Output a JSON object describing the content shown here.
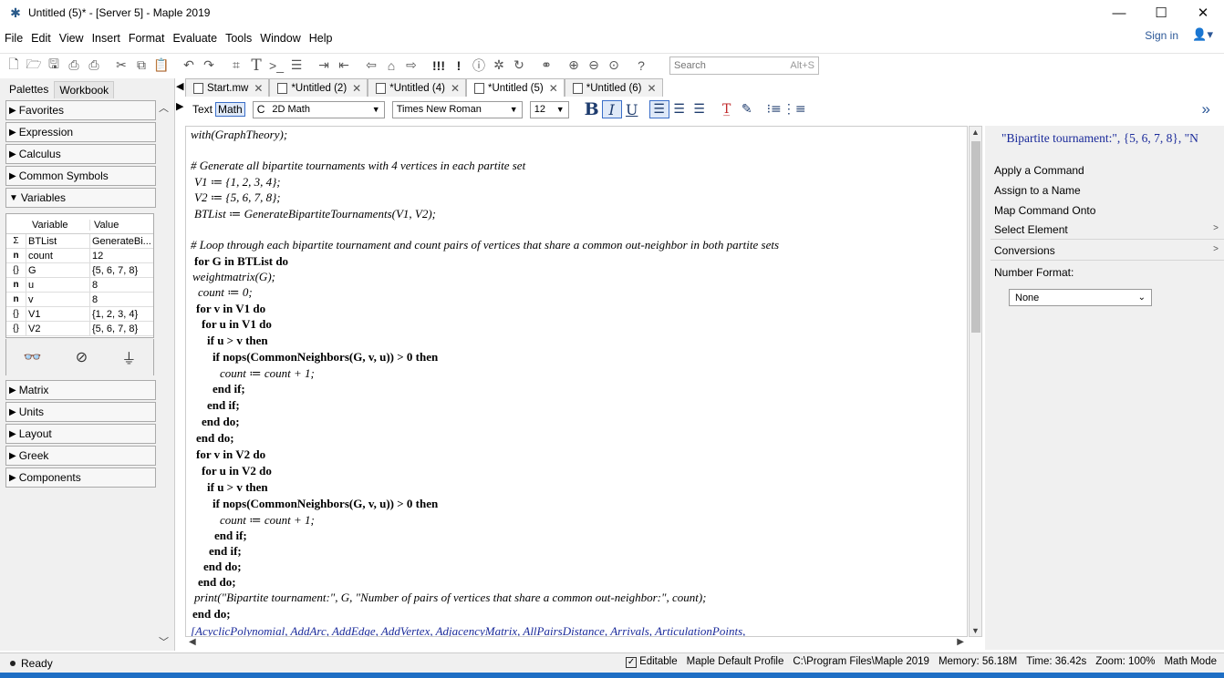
{
  "window": {
    "title": "Untitled (5)* - [Server 5] - Maple 2019",
    "minimize": "—",
    "maximize": "☐",
    "close": "✕"
  },
  "menu": [
    "File",
    "Edit",
    "View",
    "Insert",
    "Format",
    "Evaluate",
    "Tools",
    "Window",
    "Help"
  ],
  "signin": "Sign in",
  "toolbar": {
    "search_placeholder": "Search",
    "search_hint": "Alt+S"
  },
  "left_panel": {
    "tabs": [
      "Palettes",
      "Workbook"
    ],
    "palettes_top": [
      "Favorites",
      "Expression",
      "Calculus",
      "Common Symbols",
      "Variables"
    ],
    "var_columns": [
      "Variable",
      "Value"
    ],
    "variables": [
      {
        "type": "Σ",
        "name": "BTList",
        "value": "GenerateBi..."
      },
      {
        "type": "n",
        "name": "count",
        "value": "12"
      },
      {
        "type": "{}",
        "name": "G",
        "value": "{5, 6, 7, 8}"
      },
      {
        "type": "n",
        "name": "u",
        "value": "8"
      },
      {
        "type": "n",
        "name": "v",
        "value": "8"
      },
      {
        "type": "{}",
        "name": "V1",
        "value": "{1, 2, 3, 4}"
      },
      {
        "type": "{}",
        "name": "V2",
        "value": "{5, 6, 7, 8}"
      }
    ],
    "palettes_bottom": [
      "Matrix",
      "Units",
      "Layout",
      "Greek",
      "Components"
    ]
  },
  "doc_tabs": [
    {
      "label": "Start.mw",
      "active": false
    },
    {
      "label": "*Untitled (2)",
      "active": false
    },
    {
      "label": "*Untitled (4)",
      "active": false
    },
    {
      "label": "*Untitled (5)",
      "active": true
    },
    {
      "label": "*Untitled (6)",
      "active": false
    }
  ],
  "format_bar": {
    "text_mode": "Text",
    "math_mode": "Math",
    "style": "2D Math",
    "style_prefix": "C",
    "font": "Times New Roman",
    "size": "12"
  },
  "document": {
    "lines": [
      "with(GraphTheory);",
      "# Generate all bipartite tournaments with 4 vertices in each partite set",
      "V1 ≔ {1, 2, 3, 4};",
      "V2 ≔ {5, 6, 7, 8};",
      "BTList ≔ GenerateBipartiteTournaments(V1, V2);",
      "# Loop through each bipartite tournament and count pairs of vertices that share a common out-neighbor in both partite sets",
      "for G in BTList do",
      "weightmatrix(G);",
      "count ≔ 0;",
      "for v in V1 do",
      "for u in V1 do",
      "if u > v then",
      "if nops(CommonNeighbors(G, v, u)) > 0 then",
      "count ≔ count + 1;",
      "end if;",
      "end if;",
      "end do;",
      "end do;",
      "for v in V2 do",
      "for u in V2 do",
      "if u > v then",
      "if nops(CommonNeighbors(G, v, u)) > 0 then",
      "count ≔ count + 1;",
      "end if;",
      "end if;",
      "end do;",
      "end do;",
      "print(\"Bipartite tournament:\", G, \"Number of pairs of vertices that share a common out-neighbor:\", count);",
      "end do;",
      "[AcyclicPolynomial, AddArc, AddEdge, AddVertex, AdjacencyMatrix, AllPairsDistance, Arrivals, ArticulationPoints,"
    ]
  },
  "context_panel": {
    "preview": "\"Bipartite tournament:\", {5, 6, 7, 8}, \"N",
    "items": [
      "Apply a Command",
      "Assign to a Name",
      "Map Command Onto",
      "Select Element",
      "Conversions",
      "Number Format:"
    ],
    "number_format": "None"
  },
  "status": {
    "left": "Ready",
    "editable": "Editable",
    "profile": "Maple Default Profile",
    "path": "C:\\Program Files\\Maple 2019",
    "memory": "Memory: 56.18M",
    "time": "Time: 36.42s",
    "zoom": "Zoom: 100%",
    "mode": "Math Mode"
  }
}
